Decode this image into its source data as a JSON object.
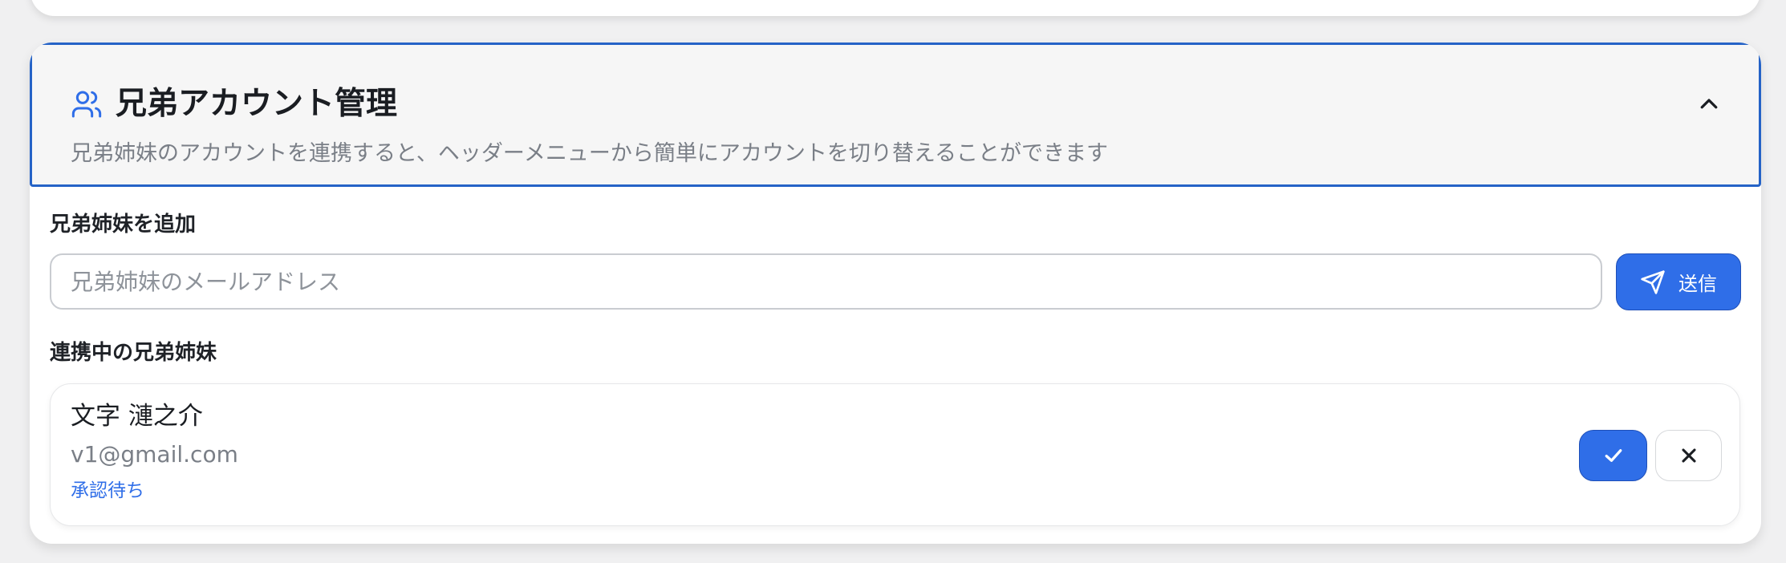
{
  "header": {
    "icon": "users-icon",
    "title": "兄弟アカウント管理",
    "description": "兄弟姉妹のアカウントを連携すると、ヘッダーメニューから簡単にアカウントを切り替えることができます",
    "toggle_icon": "chevron-up-icon"
  },
  "add_sibling": {
    "label": "兄弟姉妹を追加",
    "email_value": "",
    "email_placeholder": "兄弟姉妹のメールアドレス",
    "send_label": "送信",
    "send_icon": "send-icon"
  },
  "linked_siblings": {
    "label": "連携中の兄弟姉妹",
    "items": [
      {
        "name": "文字 漣之介",
        "email": "v1@gmail.com",
        "status": "承認待ち",
        "approve_icon": "check-icon",
        "reject_icon": "close-icon"
      }
    ]
  },
  "colors": {
    "accent": "#2f6ee8",
    "header_border": "#2563c7",
    "header_bg": "#f6f6f6",
    "muted_text": "#7a7f87"
  }
}
